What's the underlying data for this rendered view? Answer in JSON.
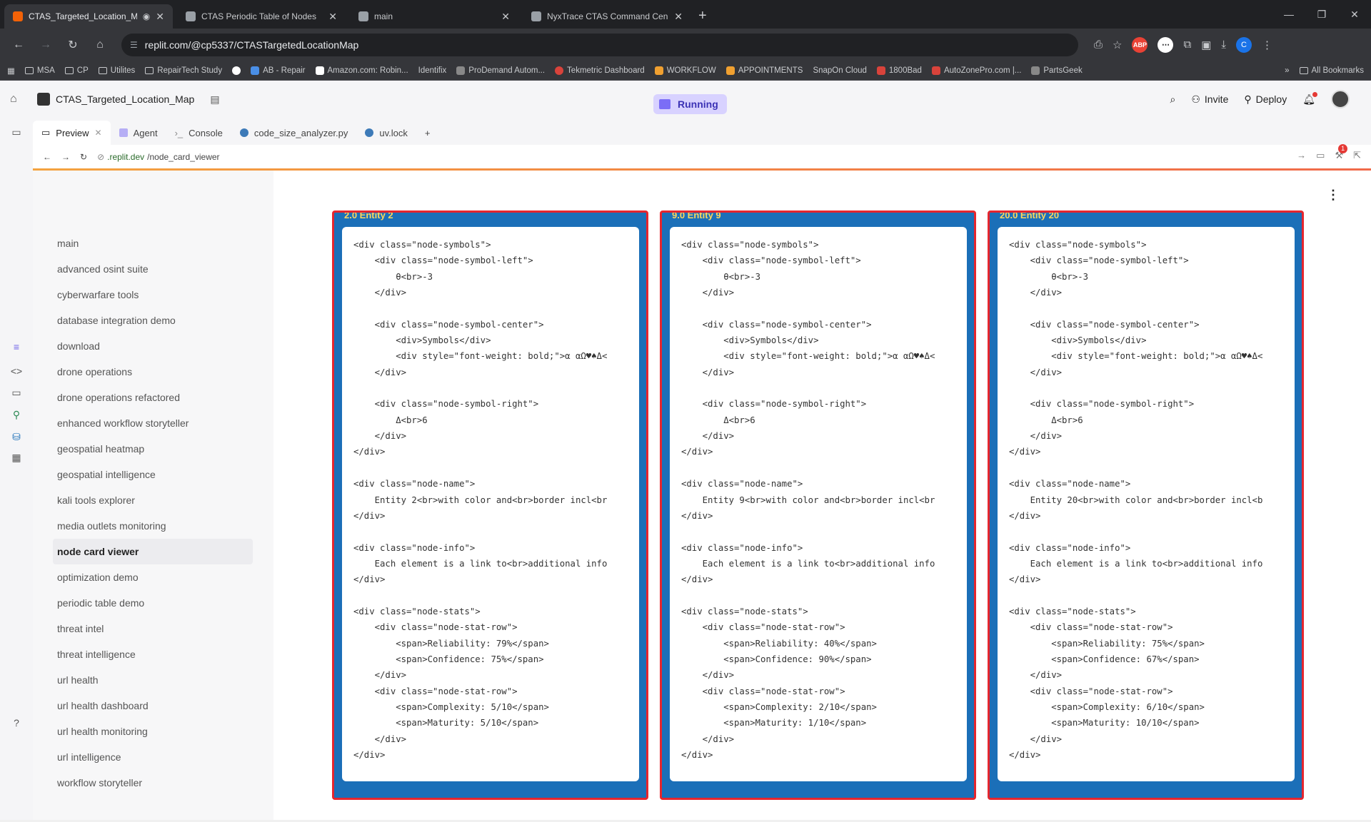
{
  "browser": {
    "tabs": [
      {
        "title": "CTAS_Targeted_Location_M",
        "active": true,
        "favicon_color": "#f26207"
      },
      {
        "title": "CTAS Periodic Table of Nodes",
        "active": false,
        "favicon_color": "#bbbbbb"
      },
      {
        "title": "main",
        "active": false,
        "favicon_color": "#bbbbbb"
      },
      {
        "title": "NyxTrace CTAS Command Cen",
        "active": false,
        "favicon_color": "#bbbbbb"
      }
    ],
    "url": "replit.com/@cp5337/CTASTargetedLocationMap",
    "profile_initial": "C",
    "ext_badge": "ABP",
    "bookmarks": [
      "MSA",
      "CP",
      "Utilites",
      "RepairTech Study",
      "AB - Repair",
      "Amazon.com: Robin...",
      "Identifix",
      "ProDemand Autom...",
      "Tekmetric Dashboard",
      "WORKFLOW",
      "APPOINTMENTS",
      "SnapOn Cloud",
      "1800Bad",
      "AutoZonePro.com |...",
      "PartsGeek"
    ],
    "all_bookmarks": "All Bookmarks"
  },
  "replit": {
    "repl_name": "CTAS_Targeted_Location_Map",
    "status": "Running",
    "invite": "Invite",
    "deploy": "Deploy",
    "pane_tabs": [
      "Preview",
      "Agent",
      "Console",
      "code_size_analyzer.py",
      "uv.lock"
    ],
    "preview_url_host": ".replit.dev",
    "preview_url_path": "/node_card_viewer",
    "notif_count": "1"
  },
  "sidebar": {
    "items": [
      "main",
      "advanced osint suite",
      "cyberwarfare tools",
      "database integration demo",
      "download",
      "drone operations",
      "drone operations refactored",
      "enhanced workflow storyteller",
      "geospatial heatmap",
      "geospatial intelligence",
      "kali tools explorer",
      "media outlets monitoring",
      "node card viewer",
      "optimization demo",
      "periodic table demo",
      "threat intel",
      "threat intelligence",
      "url health",
      "url health dashboard",
      "url health monitoring",
      "url intelligence",
      "workflow storyteller"
    ],
    "active_index": 12
  },
  "cards": [
    {
      "title": "2.0 Entity 2",
      "code": "<div class=\"node-symbols\">\n    <div class=\"node-symbol-left\">\n        θ<br>-3\n    </div>\n\n    <div class=\"node-symbol-center\">\n        <div>Symbols</div>\n        <div style=\"font-weight: bold;\">α αΩ♥♠Δ<\n    </div>\n\n    <div class=\"node-symbol-right\">\n        Δ<br>6\n    </div>\n</div>\n\n<div class=\"node-name\">\n    Entity 2<br>with color and<br>border incl<br\n</div>\n\n<div class=\"node-info\">\n    Each element is a link to<br>additional info\n</div>\n\n<div class=\"node-stats\">\n    <div class=\"node-stat-row\">\n        <span>Reliability: 79%</span>\n        <span>Confidence: 75%</span>\n    </div>\n    <div class=\"node-stat-row\">\n        <span>Complexity: 5/10</span>\n        <span>Maturity: 5/10</span>\n    </div>\n</div>"
    },
    {
      "title": "9.0 Entity 9",
      "code": "<div class=\"node-symbols\">\n    <div class=\"node-symbol-left\">\n        θ<br>-3\n    </div>\n\n    <div class=\"node-symbol-center\">\n        <div>Symbols</div>\n        <div style=\"font-weight: bold;\">α αΩ♥♠Δ<\n    </div>\n\n    <div class=\"node-symbol-right\">\n        Δ<br>6\n    </div>\n</div>\n\n<div class=\"node-name\">\n    Entity 9<br>with color and<br>border incl<br\n</div>\n\n<div class=\"node-info\">\n    Each element is a link to<br>additional info\n</div>\n\n<div class=\"node-stats\">\n    <div class=\"node-stat-row\">\n        <span>Reliability: 40%</span>\n        <span>Confidence: 90%</span>\n    </div>\n    <div class=\"node-stat-row\">\n        <span>Complexity: 2/10</span>\n        <span>Maturity: 1/10</span>\n    </div>\n</div>"
    },
    {
      "title": "20.0 Entity 20",
      "code": "<div class=\"node-symbols\">\n    <div class=\"node-symbol-left\">\n        θ<br>-3\n    </div>\n\n    <div class=\"node-symbol-center\">\n        <div>Symbols</div>\n        <div style=\"font-weight: bold;\">α αΩ♥♠Δ<\n    </div>\n\n    <div class=\"node-symbol-right\">\n        Δ<br>6\n    </div>\n</div>\n\n<div class=\"node-name\">\n    Entity 20<br>with color and<br>border incl<b\n</div>\n\n<div class=\"node-info\">\n    Each element is a link to<br>additional info\n</div>\n\n<div class=\"node-stats\">\n    <div class=\"node-stat-row\">\n        <span>Reliability: 75%</span>\n        <span>Confidence: 67%</span>\n    </div>\n    <div class=\"node-stat-row\">\n        <span>Complexity: 6/10</span>\n        <span>Maturity: 10/10</span>\n    </div>\n</div>"
    }
  ],
  "colors": {
    "card_bg": "#1b6fb8",
    "card_border": "#e5262e",
    "running_bg": "#d8d2ff",
    "running_text": "#3b32b5"
  }
}
